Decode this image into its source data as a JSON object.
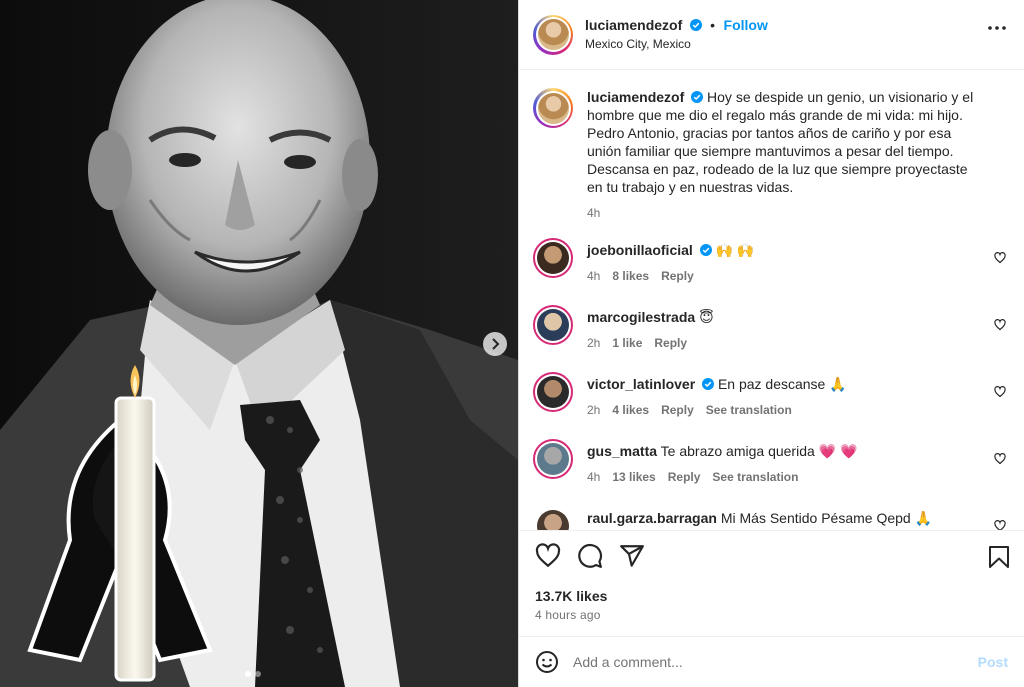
{
  "post": {
    "author": "luciamendezof",
    "follow_label": "Follow",
    "separator": "•",
    "location": "Mexico City, Mexico"
  },
  "caption": {
    "username": "luciamendezof",
    "text": "Hoy se despide un genio, un visionario y el hombre que me dio el regalo más grande de mi vida: mi hijo. Pedro Antonio, gracias por tantos años de cariño y por esa unión familiar que siempre mantuvimos a pesar del tiempo. Descansa en paz, rodeado de la luz que siempre proyectaste en tu trabajo y en nuestras vidas.",
    "time": "4h"
  },
  "comments": [
    {
      "username": "joebonillaoficial",
      "verified": true,
      "text": "🙌 🙌",
      "time": "4h",
      "likes": "8 likes",
      "reply": "Reply",
      "translation": ""
    },
    {
      "username": "marcogilestrada",
      "verified": false,
      "text": "😇",
      "time": "2h",
      "likes": "1 like",
      "reply": "Reply",
      "translation": ""
    },
    {
      "username": "victor_latinlover",
      "verified": true,
      "text": "En paz descanse 🙏",
      "time": "2h",
      "likes": "4 likes",
      "reply": "Reply",
      "translation": "See translation"
    },
    {
      "username": "gus_matta",
      "verified": false,
      "text": "Te abrazo amiga querida 💗 💗",
      "time": "4h",
      "likes": "13 likes",
      "reply": "Reply",
      "translation": "See translation"
    },
    {
      "username": "raul.garza.barragan",
      "verified": false,
      "text": "Mi Más Sentido Pésame Qepd 🙏",
      "time": "",
      "likes": "",
      "reply": "",
      "translation": ""
    }
  ],
  "footer": {
    "likes": "13.7K likes",
    "time": "4 hours ago",
    "comment_placeholder": "Add a comment...",
    "post_label": "Post"
  },
  "colors": {
    "accent": "#0095f6",
    "post_disabled": "#b3dbff",
    "verified": "#0095f6"
  },
  "icons": [
    "more-icon",
    "heart-icon",
    "comment-icon",
    "share-icon",
    "bookmark-icon",
    "emoji-icon",
    "chevron-right-icon",
    "verified-icon"
  ]
}
